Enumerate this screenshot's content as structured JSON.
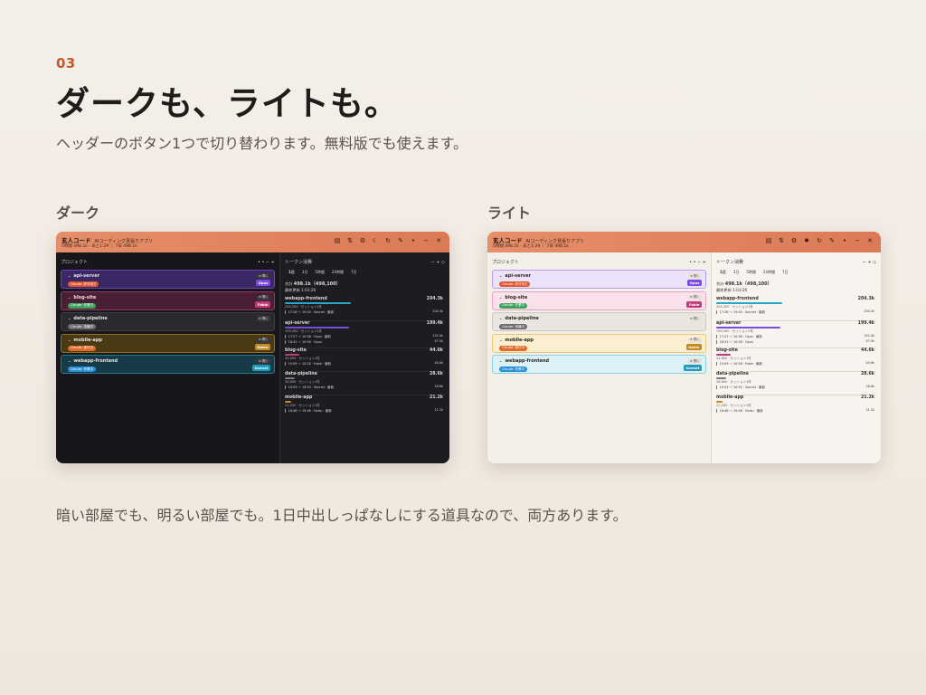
{
  "slide": {
    "number": "03",
    "headline": "ダークも、ライトも。",
    "subtitle": "ヘッダーのボタン1つで切り替わります。無料版でも使えます。",
    "label_dark": "ダーク",
    "label_light": "ライト",
    "caption": "暗い部屋でも、明るい部屋でも。1日中出しっぱなしにする道具なので、両方あります。"
  },
  "app": {
    "title": "玄人コード",
    "subtitle": "AIコーディング見張りアプリ",
    "meta": "5時間 498.1k · あと1:29 ｜ 7日 498.1k",
    "toolbar_icons": [
      "list-icon",
      "sort-icon",
      "settings-icon",
      "theme-icon",
      "refresh-icon",
      "pin-icon",
      "dot-icon",
      "minimize-icon",
      "close-icon"
    ],
    "projects_header": "プロジェクト",
    "projects_header_icons": "• •   −   +",
    "usage_header": "トークン消費",
    "usage_header_icons": "−   +   ◇",
    "tabs": [
      "1日",
      "3日",
      "5時間",
      "24時間",
      "7日"
    ],
    "open_label": "≡ 開く",
    "summary": {
      "total_label": "合計",
      "total_value": "498.1k（498,100）",
      "updated": "最終更新 1:03:26"
    },
    "projects": [
      {
        "name": "api-server",
        "badge": "Claude: 許可待ち",
        "badge_color": "#e0552e",
        "model": "Opus",
        "model_color": "#7b4be0",
        "dark_bg": "#3a2763",
        "dark_border": "#6a45b8",
        "light_bg": "#ece2fb",
        "light_border": "#b89cf0"
      },
      {
        "name": "blog-site",
        "badge": "Claude: 作業中",
        "badge_color": "#3aa35a",
        "model": "Fable",
        "model_color": "#c23a7a",
        "dark_bg": "#4a1f35",
        "dark_border": "#8e3a62",
        "light_bg": "#fbe1ec",
        "light_border": "#eaa2c2"
      },
      {
        "name": "data-pipeline",
        "badge": "Claude: 待機中",
        "badge_color": "#6d6a70",
        "model": "",
        "model_color": "",
        "dark_bg": "#2a292e",
        "dark_border": "#3e3c44",
        "light_bg": "#e9e5e0",
        "light_border": "#cfc8c0"
      },
      {
        "name": "mobile-app",
        "badge": "Claude: 実行中",
        "badge_color": "#e06a2a",
        "model": "Haiku",
        "model_color": "#c08a25",
        "dark_bg": "#4a3a14",
        "dark_border": "#8e6f22",
        "light_bg": "#fbefcf",
        "light_border": "#e8c878"
      },
      {
        "name": "webapp-frontend",
        "badge": "Claude: 作業中",
        "badge_color": "#2a8fd8",
        "model": "Sonnet",
        "model_color": "#1f9ab8",
        "dark_bg": "#163a48",
        "dark_border": "#2a7890",
        "light_bg": "#dcf1f6",
        "light_border": "#8ccfe0"
      }
    ],
    "usage": [
      {
        "name": "webapp-frontend",
        "total": "204.3k",
        "bar_color": "#2aa7c8",
        "bar_pct": 0.41,
        "detail": "204,300 · セッション1件",
        "entries": [
          {
            "text": "17:26 〜 19:00 · Sonnet · 最新",
            "value": "204.3k"
          }
        ]
      },
      {
        "name": "api-server",
        "total": "199.4k",
        "bar_color": "#7b4be0",
        "bar_pct": 0.4,
        "detail": "199,400 · セッション2件",
        "entries": [
          {
            "text": "17:27 〜 10:36 · Opus · 最新",
            "value": "152.4k"
          },
          {
            "text": "18:31 〜 10:56 · Opus",
            "value": "47.0k"
          }
        ]
      },
      {
        "name": "blog-site",
        "total": "44.6k",
        "bar_color": "#c23a7a",
        "bar_pct": 0.09,
        "detail": "44,600 · セッション1件",
        "entries": [
          {
            "text": "15:09 〜 10:26 · Fable · 最新",
            "value": "44.6k"
          }
        ]
      },
      {
        "name": "data-pipeline",
        "total": "28.6k",
        "bar_color": "#7a7680",
        "bar_pct": 0.06,
        "detail": "28,600 · セッション1件",
        "entries": [
          {
            "text": "10:53 〜 10:53 · Sonnet · 最新",
            "value": "28.6k"
          }
        ]
      },
      {
        "name": "mobile-app",
        "total": "21.2k",
        "bar_color": "#c08a25",
        "bar_pct": 0.04,
        "detail": "21,200 · セッション1件",
        "entries": [
          {
            "text": "16:48 〜 19:46 · Haiku · 最新",
            "value": "21.2k"
          }
        ]
      }
    ]
  },
  "colors": {
    "accent": "#c4582a",
    "titlebar": "#e08a64"
  }
}
